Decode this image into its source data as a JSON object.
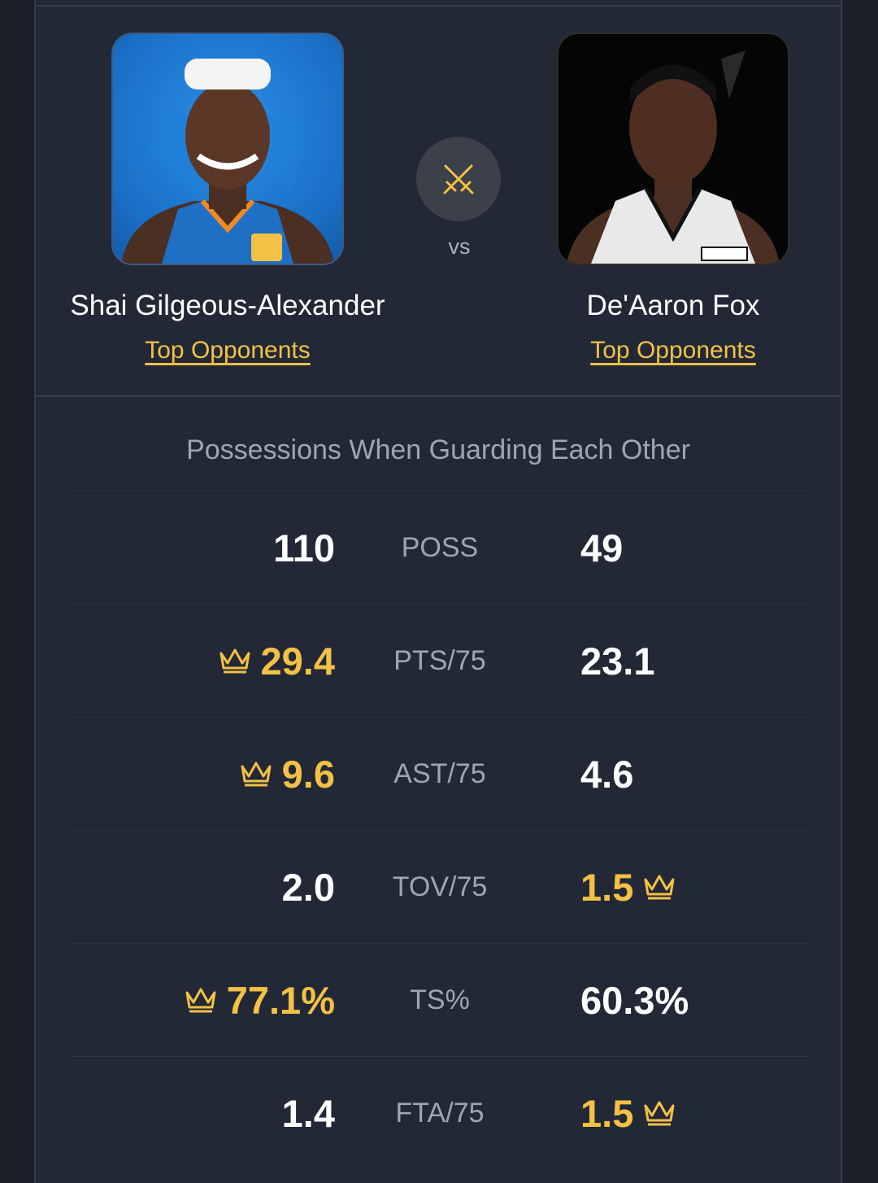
{
  "players": {
    "left": {
      "name": "Shai Gilgeous-Alexander",
      "link": "Top Opponents"
    },
    "right": {
      "name": "De'Aaron Fox",
      "link": "Top Opponents"
    }
  },
  "vs_label": "vs",
  "section_title": "Possessions When Guarding Each Other",
  "stats": [
    {
      "label": "POSS",
      "left": "110",
      "right": "49",
      "winner": "none"
    },
    {
      "label": "PTS/75",
      "left": "29.4",
      "right": "23.1",
      "winner": "left"
    },
    {
      "label": "AST/75",
      "left": "9.6",
      "right": "4.6",
      "winner": "left"
    },
    {
      "label": "TOV/75",
      "left": "2.0",
      "right": "1.5",
      "winner": "right"
    },
    {
      "label": "TS%",
      "left": "77.1%",
      "right": "60.3%",
      "winner": "left"
    },
    {
      "label": "FTA/75",
      "left": "1.4",
      "right": "1.5",
      "winner": "right"
    }
  ],
  "colors": {
    "accent": "#f3c145",
    "background": "#222836",
    "muted": "#9fa6b3"
  },
  "icons": {
    "vs": "crossed-swords-icon",
    "winner": "crown-icon"
  }
}
